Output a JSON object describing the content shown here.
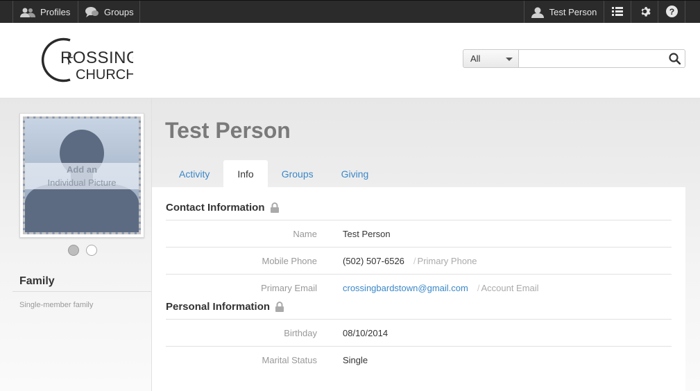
{
  "topbar": {
    "profiles": "Profiles",
    "groups": "Groups",
    "user": "Test Person"
  },
  "header": {
    "search": {
      "scope": "All",
      "placeholder": ""
    }
  },
  "profile": {
    "name": "Test Person",
    "photo_text_line1": "Add an",
    "photo_text_line2": "Individual Picture"
  },
  "tabs": [
    {
      "label": "Activity"
    },
    {
      "label": "Info"
    },
    {
      "label": "Groups"
    },
    {
      "label": "Giving"
    }
  ],
  "sidebar": {
    "family_title": "Family",
    "family_text": "Single-member family"
  },
  "contact": {
    "title": "Contact Information",
    "rows": [
      {
        "label": "Name",
        "value": "Test Person",
        "extra": ""
      },
      {
        "label": "Mobile Phone",
        "value": "(502) 507-6526",
        "extra": "Primary Phone"
      },
      {
        "label": "Primary Email",
        "value": "crossingbardstown@gmail.com",
        "extra": "Account Email"
      }
    ]
  },
  "personal": {
    "title": "Personal Information",
    "rows": [
      {
        "label": "Birthday",
        "value": "08/10/2014"
      },
      {
        "label": "Marital Status",
        "value": "Single"
      }
    ]
  },
  "colors": {
    "accent": "#3a87c8",
    "topbar": "#2b2b2b"
  }
}
